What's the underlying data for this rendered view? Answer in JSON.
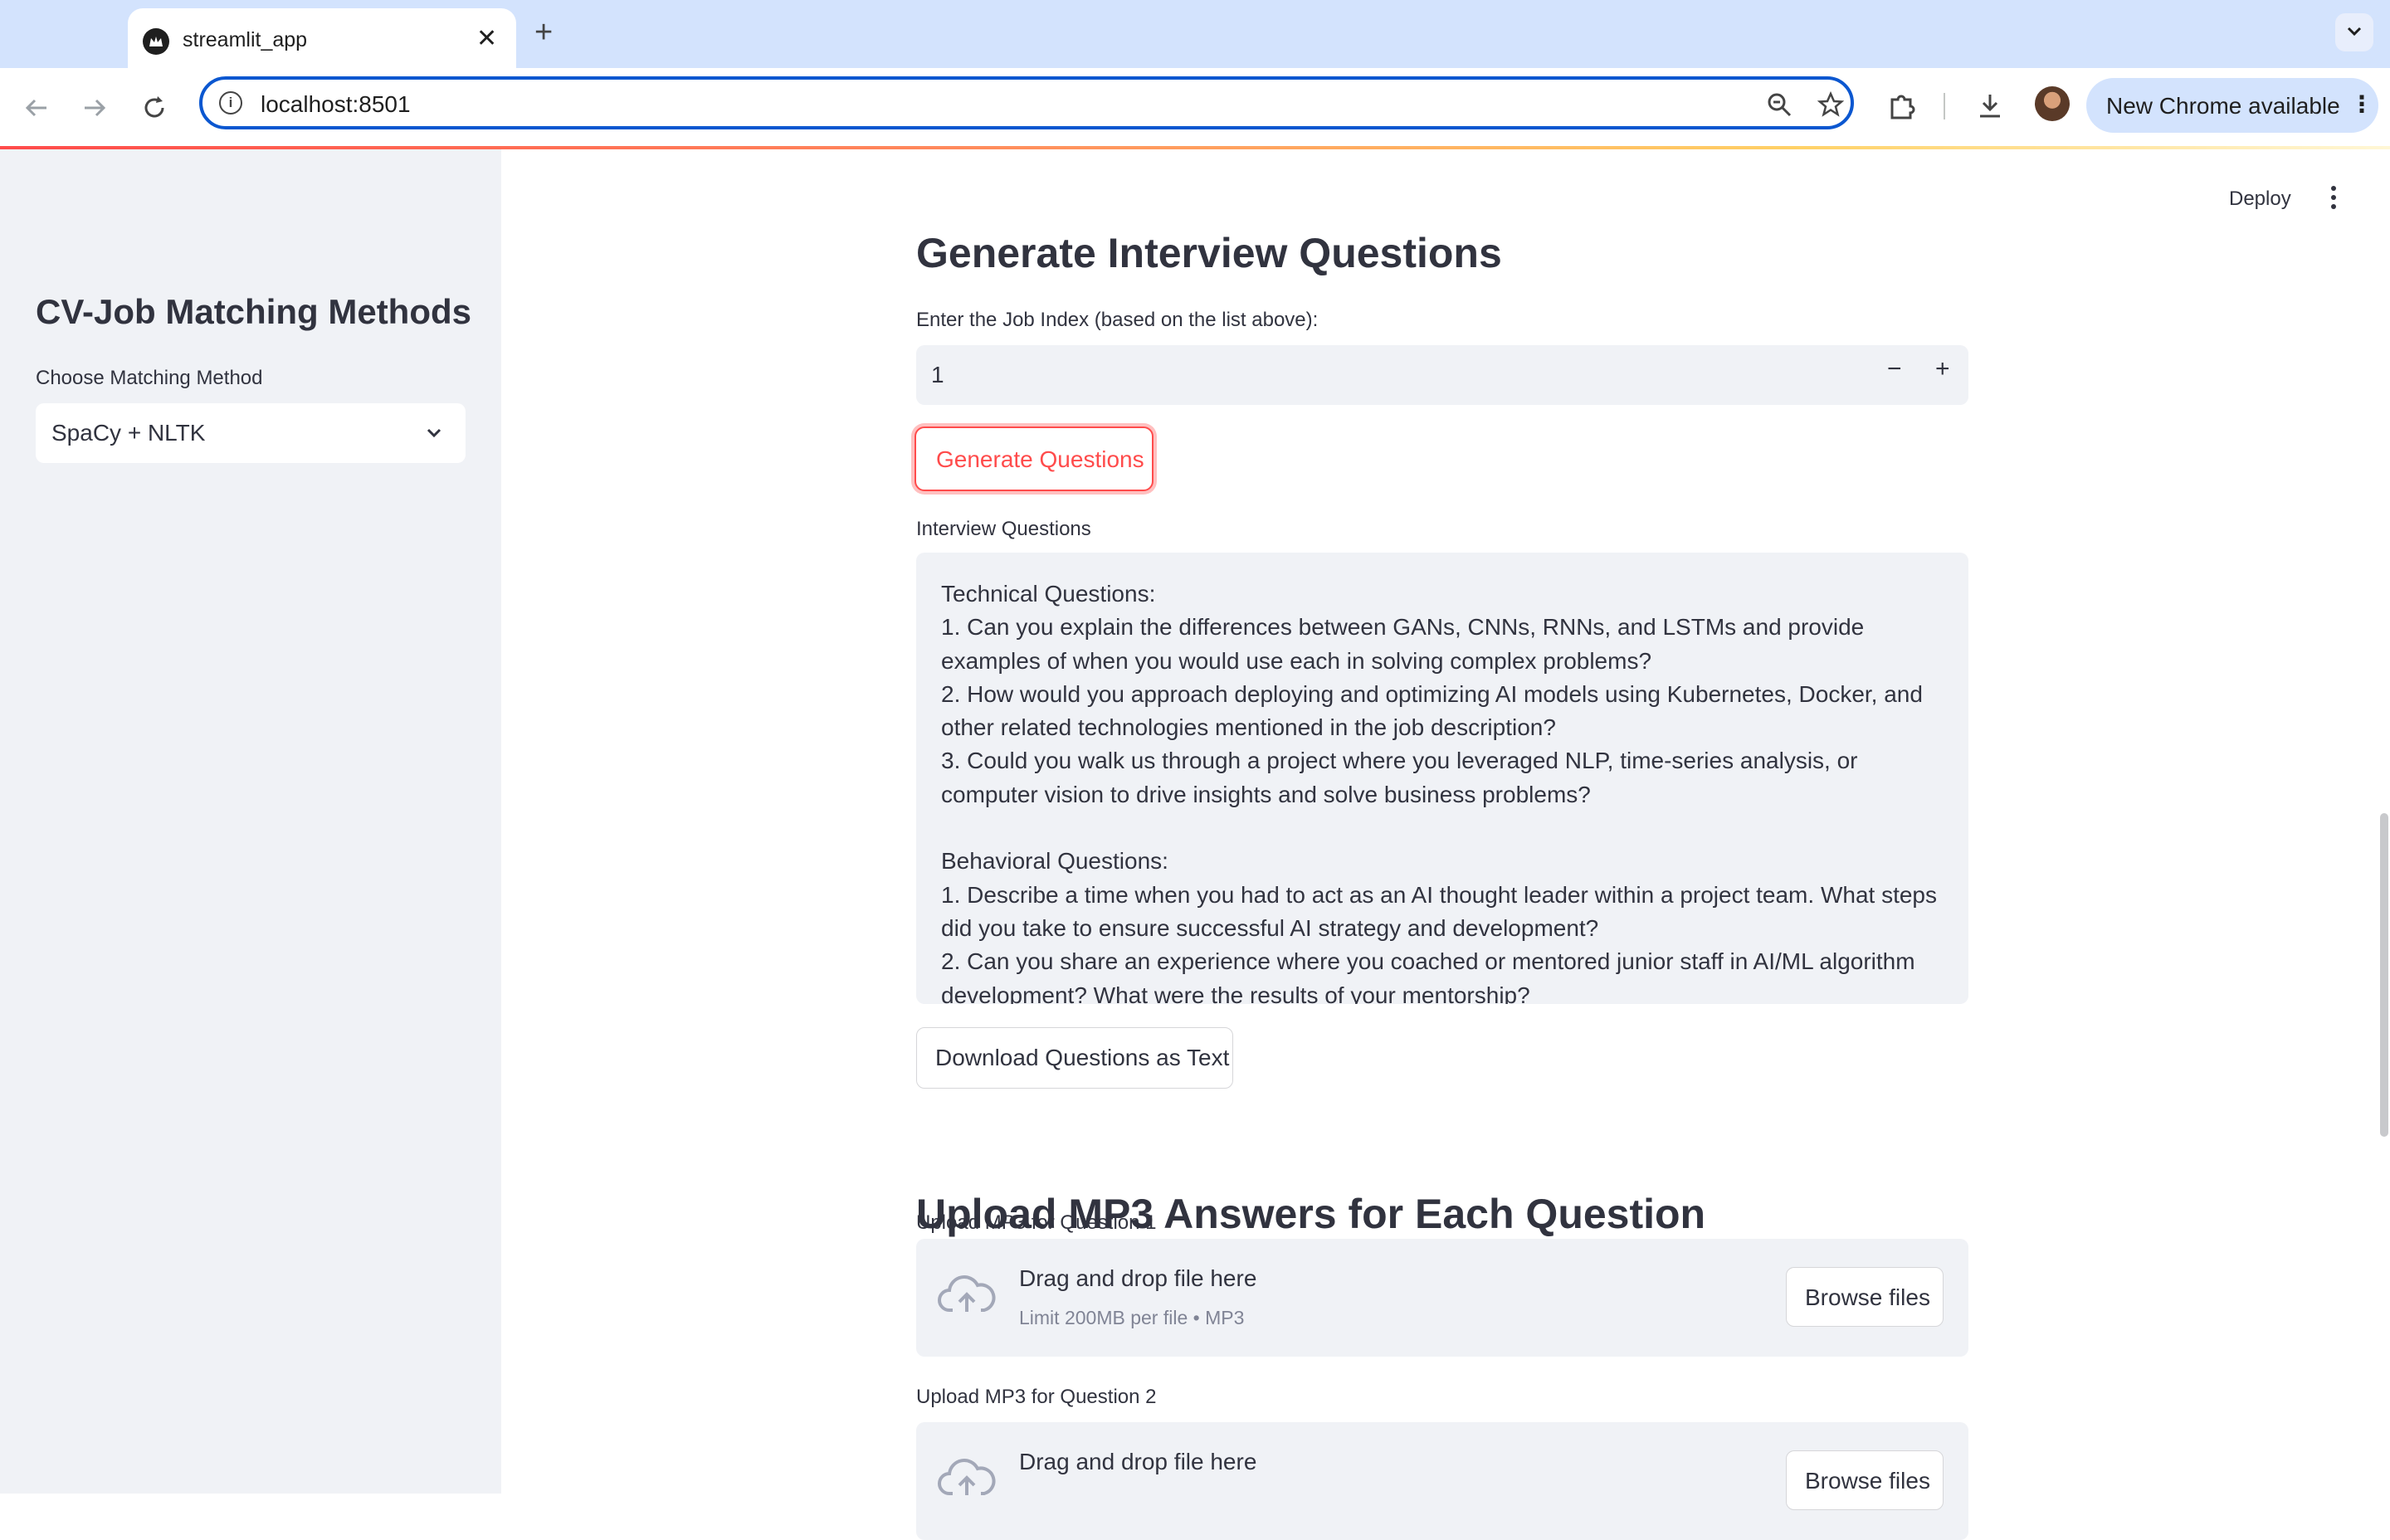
{
  "browser": {
    "tab_title": "streamlit_app",
    "url": "localhost:8501",
    "update_label": "New Chrome available"
  },
  "sidebar": {
    "title": "CV-Job Matching Methods",
    "method_label": "Choose Matching Method",
    "method_value": "SpaCy + NLTK"
  },
  "header": {
    "deploy_label": "Deploy"
  },
  "main": {
    "generate_heading": "Generate Interview Questions",
    "job_index_label": "Enter the Job Index (based on the list above):",
    "job_index_value": "1",
    "generate_button": "Generate Questions",
    "questions_label": "Interview Questions",
    "questions_text": "Technical Questions:\n1. Can you explain the differences between GANs, CNNs, RNNs, and LSTMs and provide examples of when you would use each in solving complex problems?\n2. How would you approach deploying and optimizing AI models using Kubernetes, Docker, and other related technologies mentioned in the job description?\n3. Could you walk us through a project where you leveraged NLP, time-series analysis, or computer vision to drive insights and solve business problems?\n\nBehavioral Questions:\n1. Describe a time when you had to act as an AI thought leader within a project team. What steps did you take to ensure successful AI strategy and development?\n2. Can you share an experience where you coached or mentored junior staff in AI/ML algorithm development? What were the results of your mentorship?",
    "download_button": "Download Questions as Text",
    "upload_heading": "Upload MP3 Answers for Each Question",
    "uploaders": [
      {
        "label": "Upload MP3 for Question 1",
        "title": "Drag and drop file here",
        "limit": "Limit 200MB per file • MP3",
        "button": "Browse files"
      },
      {
        "label": "Upload MP3 for Question 2",
        "title": "Drag and drop file here",
        "button": "Browse files"
      }
    ]
  }
}
